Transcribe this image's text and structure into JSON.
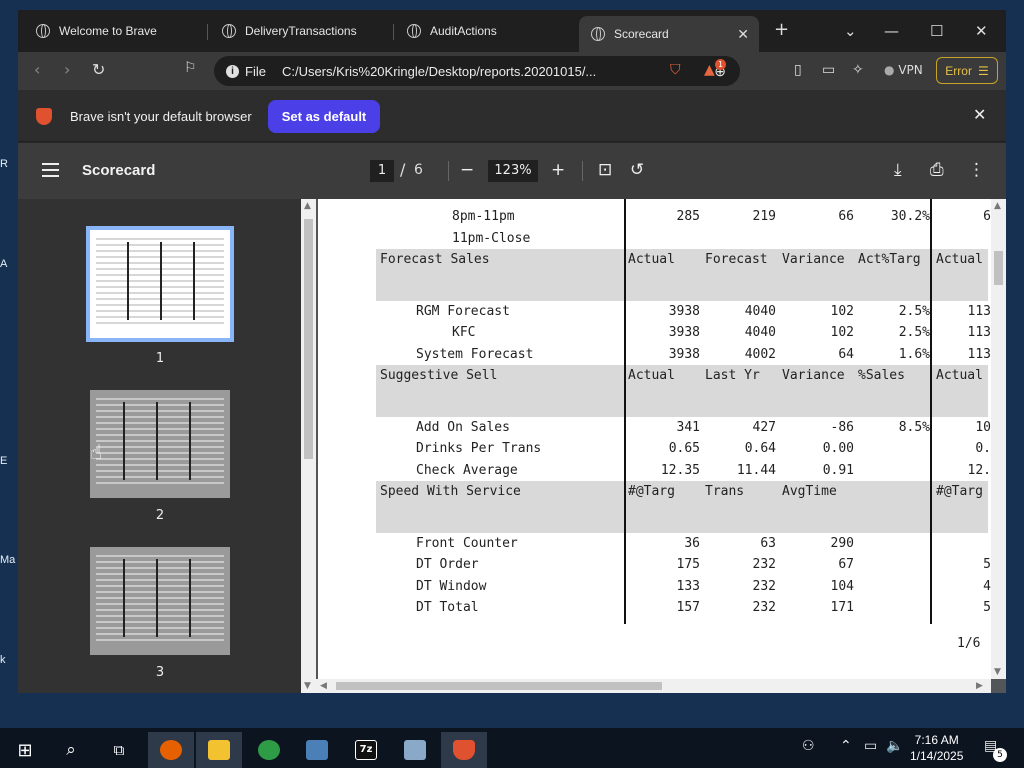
{
  "browser": {
    "tabs": [
      {
        "label": "Welcome to Brave"
      },
      {
        "label": "DeliveryTransactions"
      },
      {
        "label": "AuditActions"
      },
      {
        "label": "Scorecard",
        "active": true
      }
    ],
    "new_tab": "+",
    "address_scheme": "File",
    "address_url": "C:/Users/Kris%20Kringle/Desktop/reports.20201015/...",
    "shield_badge": "1",
    "vpn_label": "VPN",
    "error_label": "Error"
  },
  "notification": {
    "text": "Brave isn't your default browser",
    "button": "Set as default"
  },
  "pdf": {
    "title": "Scorecard",
    "current_page": "1",
    "page_sep": "/",
    "total_pages": "6",
    "zoom": "123%",
    "footer": "1/6"
  },
  "thumbnails": [
    {
      "label": "1"
    },
    {
      "label": "2"
    },
    {
      "label": "3"
    }
  ],
  "report": {
    "rows": [
      {
        "kind": "data",
        "label": "8pm-11pm",
        "indent": 2,
        "c1": "285",
        "c2": "219",
        "c3": "66",
        "c4": "30.2%",
        "c5": "6"
      },
      {
        "kind": "data",
        "label": "11pm-Close",
        "indent": 2,
        "c1": "",
        "c2": "",
        "c3": "",
        "c4": "",
        "c5": ""
      },
      {
        "kind": "header",
        "label": "Forecast Sales",
        "c1": "Actual",
        "c2": "Forecast",
        "c3": "Variance",
        "c4": "Act%Targ",
        "c5": "Actual"
      },
      {
        "kind": "data",
        "label": "RGM Forecast",
        "indent": 1,
        "c1": "3938",
        "c2": "4040",
        "c3": "102",
        "c4": "2.5%",
        "c5": "113"
      },
      {
        "kind": "data",
        "label": "KFC",
        "indent": 2,
        "c1": "3938",
        "c2": "4040",
        "c3": "102",
        "c4": "2.5%",
        "c5": "113"
      },
      {
        "kind": "data",
        "label": "System Forecast",
        "indent": 1,
        "c1": "3938",
        "c2": "4002",
        "c3": "64",
        "c4": "1.6%",
        "c5": "113"
      },
      {
        "kind": "header",
        "label": "Suggestive Sell",
        "c1": "Actual",
        "c2": "Last Yr",
        "c3": "Variance",
        "c4": "%Sales",
        "c5": "Actual"
      },
      {
        "kind": "data",
        "label": "Add On Sales",
        "indent": 1,
        "c1": "341",
        "c2": "427",
        "c3": "-86",
        "c4": "8.5%",
        "c5": "10"
      },
      {
        "kind": "data",
        "label": "Drinks Per Trans",
        "indent": 1,
        "c1": "0.65",
        "c2": "0.64",
        "c3": "0.00",
        "c4": "",
        "c5": "0."
      },
      {
        "kind": "data",
        "label": "Check Average",
        "indent": 1,
        "c1": "12.35",
        "c2": "11.44",
        "c3": "0.91",
        "c4": "",
        "c5": "12."
      },
      {
        "kind": "header",
        "label": "Speed With Service",
        "c1": "#@Targ",
        "c2": "Trans",
        "c3": "AvgTime",
        "c4": "",
        "c5": "#@Targ"
      },
      {
        "kind": "data",
        "label": "Front Counter",
        "indent": 1,
        "c1": "36",
        "c2": "63",
        "c3": "290",
        "c4": "",
        "c5": ""
      },
      {
        "kind": "data",
        "label": "DT Order",
        "indent": 1,
        "c1": "175",
        "c2": "232",
        "c3": "67",
        "c4": "",
        "c5": "5"
      },
      {
        "kind": "data",
        "label": "DT Window",
        "indent": 1,
        "c1": "133",
        "c2": "232",
        "c3": "104",
        "c4": "",
        "c5": "4"
      },
      {
        "kind": "data",
        "label": "DT Total",
        "indent": 1,
        "c1": "157",
        "c2": "232",
        "c3": "171",
        "c4": "",
        "c5": "5"
      }
    ]
  },
  "taskbar": {
    "time": "7:16 AM",
    "date": "1/14/2025",
    "notification_count": "5"
  }
}
